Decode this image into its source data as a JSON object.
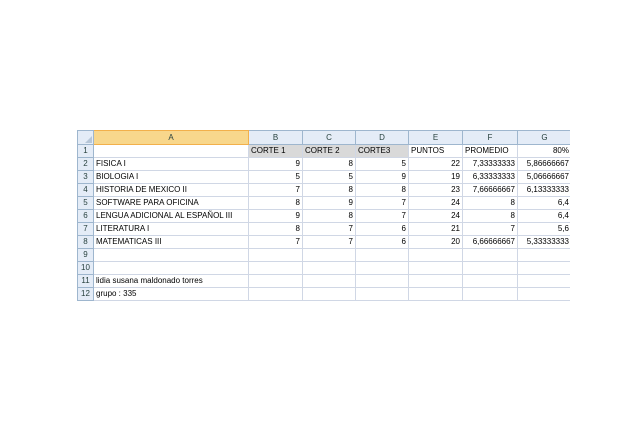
{
  "columns": [
    "A",
    "B",
    "C",
    "D",
    "E",
    "F",
    "G"
  ],
  "rows": [
    {
      "n": "1",
      "cells": [
        "",
        "CORTE 1",
        "CORTE 2",
        "CORTE3",
        "PUNTOS",
        "PROMEDIO",
        "80%"
      ]
    },
    {
      "n": "2",
      "cells": [
        "FISICA I",
        "9",
        "8",
        "5",
        "22",
        "7,33333333",
        "5,86666667"
      ]
    },
    {
      "n": "3",
      "cells": [
        "BIOLOGIA I",
        "5",
        "5",
        "9",
        "19",
        "6,33333333",
        "5,06666667"
      ]
    },
    {
      "n": "4",
      "cells": [
        "HISTORIA DE MEXICO II",
        "7",
        "8",
        "8",
        "23",
        "7,66666667",
        "6,13333333"
      ]
    },
    {
      "n": "5",
      "cells": [
        "SOFTWARE PARA OFICINA",
        "8",
        "9",
        "7",
        "24",
        "8",
        "6,4"
      ]
    },
    {
      "n": "6",
      "cells": [
        "LENGUA ADICIONAL AL ESPAÑOL III",
        "9",
        "8",
        "7",
        "24",
        "8",
        "6,4"
      ]
    },
    {
      "n": "7",
      "cells": [
        "LITERATURA I",
        "8",
        "7",
        "6",
        "21",
        "7",
        "5,6"
      ]
    },
    {
      "n": "8",
      "cells": [
        "MATEMATICAS III",
        "7",
        "7",
        "6",
        "20",
        "6,66666667",
        "5,33333333"
      ]
    },
    {
      "n": "9",
      "cells": [
        "",
        "",
        "",
        "",
        "",
        "",
        ""
      ]
    },
    {
      "n": "10",
      "cells": [
        "",
        "",
        "",
        "",
        "",
        "",
        ""
      ]
    },
    {
      "n": "11",
      "cells": [
        "lidia susana maldonado torres",
        "",
        "",
        "",
        "",
        "",
        ""
      ]
    },
    {
      "n": "12",
      "cells": [
        "grupo : 335",
        "",
        "",
        "",
        "",
        "",
        ""
      ]
    }
  ]
}
